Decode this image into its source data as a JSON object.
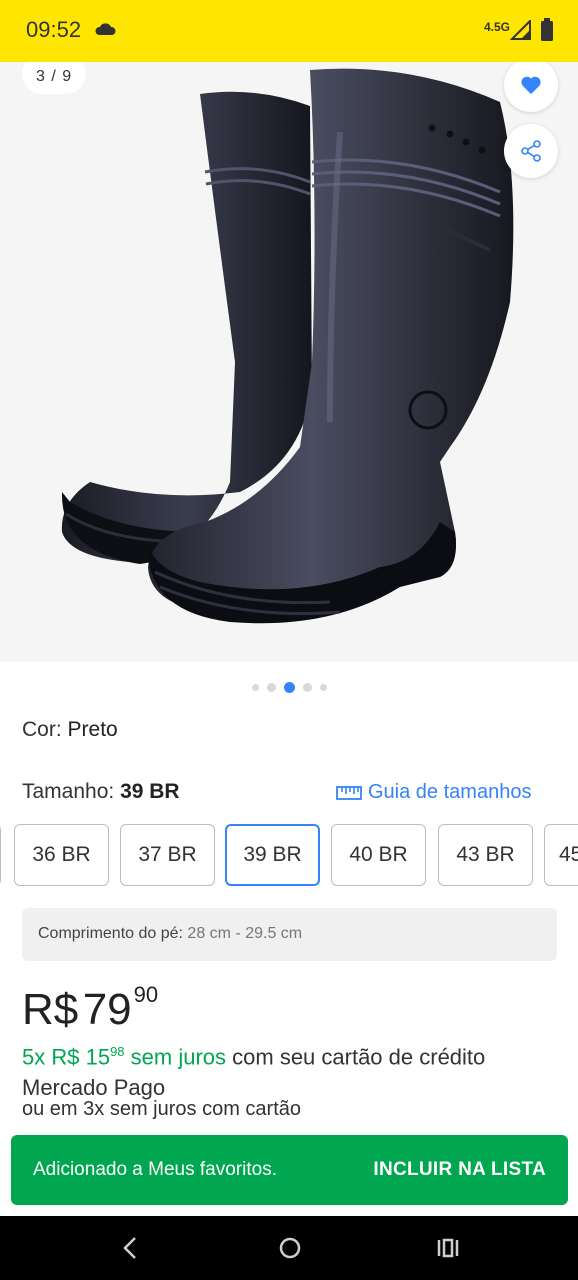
{
  "status_bar": {
    "time": "09:52",
    "network": "4.5G"
  },
  "gallery": {
    "counter": "3 / 9",
    "image_alt": "Bota de borracha preta",
    "total_dots": 5,
    "active_dot": 2
  },
  "color": {
    "label": "Cor:",
    "value": "Preto"
  },
  "size": {
    "label": "Tamanho:",
    "value": "39 BR",
    "guide_label": "Guia de tamanhos"
  },
  "size_options": [
    {
      "label": "36 BR",
      "selected": false
    },
    {
      "label": "37 BR",
      "selected": false
    },
    {
      "label": "39 BR",
      "selected": true
    },
    {
      "label": "40 BR",
      "selected": false
    },
    {
      "label": "43 BR",
      "selected": false
    },
    {
      "label": "45",
      "selected": false
    }
  ],
  "foot_length": {
    "label": "Comprimento do pé:",
    "value": "28 cm - 29.5 cm"
  },
  "price": {
    "currency": "R$",
    "integer": "79",
    "cents": "90"
  },
  "installments": {
    "count": "5x R$ 15",
    "cents": "98",
    "no_interest": "sem juros",
    "rest": "com seu cartão de crédito Mercado Pago",
    "alt": "ou em 3x sem juros com cartão"
  },
  "snackbar": {
    "message": "Adicionado a Meus favoritos.",
    "action": "INCLUIR NA LISTA"
  },
  "colors": {
    "brand_yellow": "#ffe600",
    "accent_blue": "#3483fa",
    "success_green": "#00a650"
  }
}
